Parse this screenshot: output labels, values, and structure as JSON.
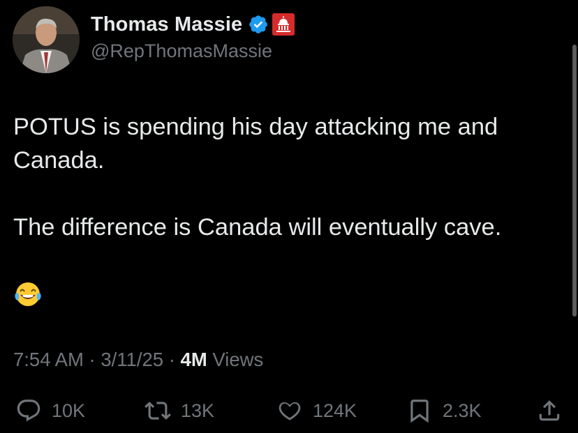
{
  "author": {
    "name": "Thomas Massie",
    "handle": "@RepThomasMassie",
    "verified": true,
    "affiliation_badge": "us-capitol-icon"
  },
  "tweet": {
    "paragraph1": "POTUS is spending his day attacking me and Canada.",
    "paragraph2": "The difference is Canada will eventually cave.",
    "emoji": "😂"
  },
  "meta": {
    "time": "7:54 AM",
    "separator": "·",
    "date": "3/11/25",
    "views_count": "4M",
    "views_label": "Views"
  },
  "actions": {
    "replies": "10K",
    "reposts": "13K",
    "likes": "124K",
    "bookmarks": "2.3K"
  },
  "colors": {
    "background": "#000000",
    "text": "#e7e9ea",
    "secondary": "#71767b",
    "verified_blue": "#1d9bf0",
    "badge_red": "#d62b2b"
  }
}
